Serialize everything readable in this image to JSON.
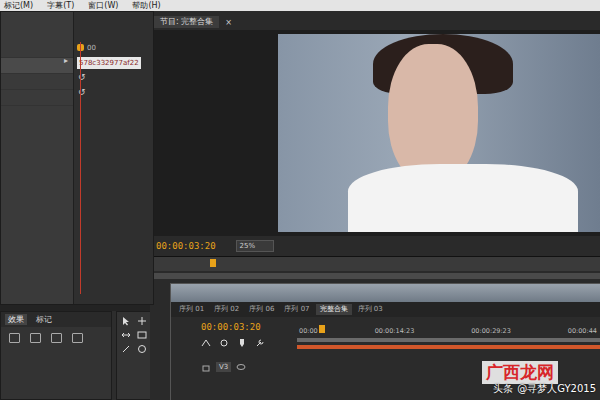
{
  "menu": [
    "标记(M)",
    "字幕(T)",
    "窗口(W)",
    "帮助(H)"
  ],
  "effect_controls": {
    "expand": "▸",
    "ruler_label": "00",
    "clip": "578c332977af22",
    "reset_icons": [
      "↺",
      "↺"
    ]
  },
  "program": {
    "title": "节目: 完整合集",
    "close": "×",
    "timecode": "00:00:03:20",
    "zoom": "25%"
  },
  "project_panel": {
    "tabs": [
      {
        "label": "效果",
        "selected": true
      },
      {
        "label": "标记",
        "selected": false
      }
    ]
  },
  "sequence": {
    "tabs": [
      {
        "label": "序列 01",
        "selected": false
      },
      {
        "label": "序列 02",
        "selected": false
      },
      {
        "label": "序列 06",
        "selected": false
      },
      {
        "label": "序列 07",
        "selected": false
      },
      {
        "label": "完整合集",
        "selected": true
      },
      {
        "label": "序列 03",
        "selected": false
      }
    ],
    "timecode": "00:00:03:20",
    "ruler": [
      "00:00",
      "00:00:14:23",
      "00:00:29:23",
      "00:00:44"
    ],
    "tracks": [
      {
        "label": "V3"
      }
    ]
  },
  "watermark": {
    "site": "头条",
    "author": "@寻梦人GY2015",
    "logo": "广西龙网"
  }
}
